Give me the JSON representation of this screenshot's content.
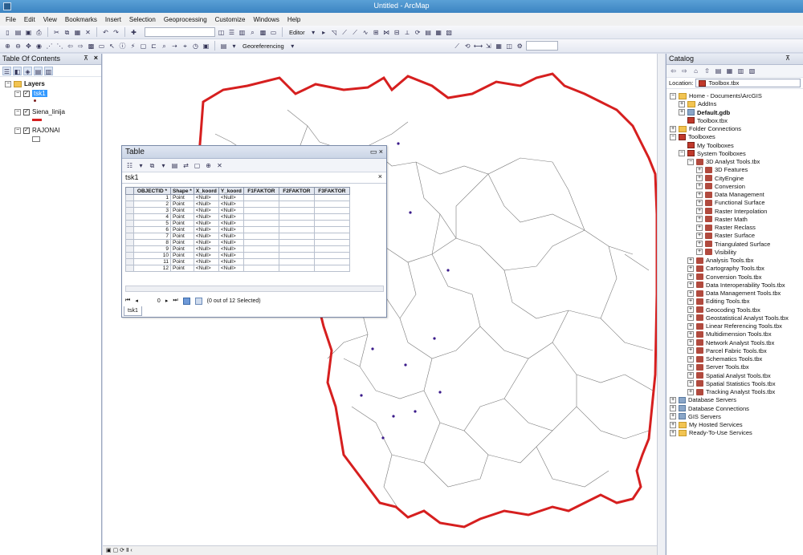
{
  "window": {
    "title": "Untitled - ArcMap"
  },
  "menu": [
    "File",
    "Edit",
    "View",
    "Bookmarks",
    "Insert",
    "Selection",
    "Geoprocessing",
    "Customize",
    "Windows",
    "Help"
  ],
  "toolbar": {
    "editor_label": "Editor",
    "georef_label": "Georeferencing"
  },
  "toc": {
    "title": "Table Of Contents",
    "root": "Layers",
    "layers": [
      {
        "name": "tsk1",
        "selected": true,
        "symbol": "point"
      },
      {
        "name": "Siena_linija",
        "selected": false,
        "symbol": "line"
      },
      {
        "name": "RAJONAI",
        "selected": false,
        "symbol": "polygon"
      }
    ]
  },
  "table": {
    "title": "Table",
    "tab_name": "tsk1",
    "columns": [
      "OBJECTID *",
      "Shape *",
      "X_koord",
      "Y_koord",
      "F1FAKTOR",
      "F2FAKTOR",
      "F3FAKTOR"
    ],
    "rows": [
      [
        "1",
        "Point",
        "<Null>",
        "<Null>",
        "",
        "",
        ""
      ],
      [
        "2",
        "Point",
        "<Null>",
        "<Null>",
        "",
        "",
        ""
      ],
      [
        "3",
        "Point",
        "<Null>",
        "<Null>",
        "",
        "",
        ""
      ],
      [
        "4",
        "Point",
        "<Null>",
        "<Null>",
        "",
        "",
        ""
      ],
      [
        "5",
        "Point",
        "<Null>",
        "<Null>",
        "",
        "",
        ""
      ],
      [
        "6",
        "Point",
        "<Null>",
        "<Null>",
        "",
        "",
        ""
      ],
      [
        "7",
        "Point",
        "<Null>",
        "<Null>",
        "",
        "",
        ""
      ],
      [
        "8",
        "Point",
        "<Null>",
        "<Null>",
        "",
        "",
        ""
      ],
      [
        "9",
        "Point",
        "<Null>",
        "<Null>",
        "",
        "",
        ""
      ],
      [
        "10",
        "Point",
        "<Null>",
        "<Null>",
        "",
        "",
        ""
      ],
      [
        "11",
        "Point",
        "<Null>",
        "<Null>",
        "",
        "",
        ""
      ],
      [
        "12",
        "Point",
        "<Null>",
        "<Null>",
        "",
        "",
        ""
      ]
    ],
    "record_value": "0",
    "selection_status": "(0 out of 12 Selected)",
    "bottom_tab": "tsk1"
  },
  "catalog": {
    "title": "Catalog",
    "location_label": "Location:",
    "location_value": "Toolbox.tbx",
    "tree": [
      {
        "label": "Home - Documents\\ArcGIS",
        "level": 0,
        "exp": "−",
        "icon": "folder"
      },
      {
        "label": "AddIns",
        "level": 1,
        "exp": "+",
        "icon": "folder"
      },
      {
        "label": "Default.gdb",
        "level": 1,
        "exp": "+",
        "icon": "db",
        "bold": true
      },
      {
        "label": "Toolbox.tbx",
        "level": 1,
        "exp": "",
        "icon": "toolbox"
      },
      {
        "label": "Folder Connections",
        "level": 0,
        "exp": "+",
        "icon": "folder"
      },
      {
        "label": "Toolboxes",
        "level": 0,
        "exp": "−",
        "icon": "toolbox"
      },
      {
        "label": "My Toolboxes",
        "level": 1,
        "exp": "",
        "icon": "toolbox"
      },
      {
        "label": "System Toolboxes",
        "level": 1,
        "exp": "−",
        "icon": "toolbox"
      },
      {
        "label": "3D Analyst Tools.tbx",
        "level": 2,
        "exp": "−",
        "icon": "tool"
      },
      {
        "label": "3D Features",
        "level": 3,
        "exp": "+",
        "icon": "tool"
      },
      {
        "label": "CityEngine",
        "level": 3,
        "exp": "+",
        "icon": "tool"
      },
      {
        "label": "Conversion",
        "level": 3,
        "exp": "+",
        "icon": "tool"
      },
      {
        "label": "Data Management",
        "level": 3,
        "exp": "+",
        "icon": "tool"
      },
      {
        "label": "Functional Surface",
        "level": 3,
        "exp": "+",
        "icon": "tool"
      },
      {
        "label": "Raster Interpolation",
        "level": 3,
        "exp": "+",
        "icon": "tool"
      },
      {
        "label": "Raster Math",
        "level": 3,
        "exp": "+",
        "icon": "tool"
      },
      {
        "label": "Raster Reclass",
        "level": 3,
        "exp": "+",
        "icon": "tool"
      },
      {
        "label": "Raster Surface",
        "level": 3,
        "exp": "+",
        "icon": "tool"
      },
      {
        "label": "Triangulated Surface",
        "level": 3,
        "exp": "+",
        "icon": "tool"
      },
      {
        "label": "Visibility",
        "level": 3,
        "exp": "+",
        "icon": "tool"
      },
      {
        "label": "Analysis Tools.tbx",
        "level": 2,
        "exp": "+",
        "icon": "tool"
      },
      {
        "label": "Cartography Tools.tbx",
        "level": 2,
        "exp": "+",
        "icon": "tool"
      },
      {
        "label": "Conversion Tools.tbx",
        "level": 2,
        "exp": "+",
        "icon": "tool"
      },
      {
        "label": "Data Interoperability Tools.tbx",
        "level": 2,
        "exp": "+",
        "icon": "tool"
      },
      {
        "label": "Data Management Tools.tbx",
        "level": 2,
        "exp": "+",
        "icon": "tool"
      },
      {
        "label": "Editing Tools.tbx",
        "level": 2,
        "exp": "+",
        "icon": "tool"
      },
      {
        "label": "Geocoding Tools.tbx",
        "level": 2,
        "exp": "+",
        "icon": "tool"
      },
      {
        "label": "Geostatistical Analyst Tools.tbx",
        "level": 2,
        "exp": "+",
        "icon": "tool"
      },
      {
        "label": "Linear Referencing Tools.tbx",
        "level": 2,
        "exp": "+",
        "icon": "tool"
      },
      {
        "label": "Multidimension Tools.tbx",
        "level": 2,
        "exp": "+",
        "icon": "tool"
      },
      {
        "label": "Network Analyst Tools.tbx",
        "level": 2,
        "exp": "+",
        "icon": "tool"
      },
      {
        "label": "Parcel Fabric Tools.tbx",
        "level": 2,
        "exp": "+",
        "icon": "tool"
      },
      {
        "label": "Schematics Tools.tbx",
        "level": 2,
        "exp": "+",
        "icon": "tool"
      },
      {
        "label": "Server Tools.tbx",
        "level": 2,
        "exp": "+",
        "icon": "tool"
      },
      {
        "label": "Spatial Analyst Tools.tbx",
        "level": 2,
        "exp": "+",
        "icon": "tool"
      },
      {
        "label": "Spatial Statistics Tools.tbx",
        "level": 2,
        "exp": "+",
        "icon": "tool"
      },
      {
        "label": "Tracking Analyst Tools.tbx",
        "level": 2,
        "exp": "+",
        "icon": "tool"
      },
      {
        "label": "Database Servers",
        "level": 0,
        "exp": "+",
        "icon": "db"
      },
      {
        "label": "Database Connections",
        "level": 0,
        "exp": "+",
        "icon": "db"
      },
      {
        "label": "GIS Servers",
        "level": 0,
        "exp": "+",
        "icon": "db"
      },
      {
        "label": "My Hosted Services",
        "level": 0,
        "exp": "+",
        "icon": "folder"
      },
      {
        "label": "Ready-To-Use Services",
        "level": 0,
        "exp": "+",
        "icon": "folder"
      }
    ]
  },
  "colors": {
    "boundary": "#d61f1f",
    "district": "#7a7a7a",
    "point": "#3a1a8a",
    "selection": "#3399ff"
  }
}
